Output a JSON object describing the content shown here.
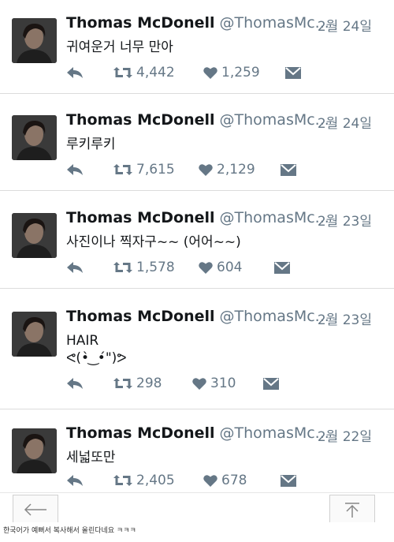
{
  "tweets": [
    {
      "name": "Thomas McDonell",
      "handle": "@ThomasMc...",
      "date": "2월 24일",
      "lines": [
        "귀여운거 너무 만아"
      ],
      "retweets": "4,442",
      "likes": "1,259"
    },
    {
      "name": "Thomas McDonell",
      "handle": "@ThomasMc...",
      "date": "2월 24일",
      "lines": [
        "루키루키"
      ],
      "retweets": "7,615",
      "likes": "2,129"
    },
    {
      "name": "Thomas McDonell",
      "handle": "@ThomasMc...",
      "date": "2월 23일",
      "lines": [
        "사진이나 찍자구~~ (어어~~)"
      ],
      "retweets": "1,578",
      "likes": "604"
    },
    {
      "name": "Thomas McDonell",
      "handle": "@ThomasMc...",
      "date": "2월 23일",
      "lines": [
        "HAIR",
        "ᕙ(•̀ ͜ •́\")ᕗ"
      ],
      "retweets": "298",
      "likes": "310"
    },
    {
      "name": "Thomas McDonell",
      "handle": "@ThomasMc...",
      "date": "2월 22일",
      "lines": [
        "세넓또만"
      ],
      "retweets": "2,405",
      "likes": "678"
    }
  ],
  "icons": {
    "reply": "reply-arrow-icon",
    "retweet": "retweet-icon",
    "like": "heart-icon",
    "dm": "direct-message-icon",
    "back": "back-arrow-icon",
    "top": "scroll-to-top-icon"
  },
  "colors": {
    "action_gray": "#657786",
    "text": "#14171a"
  },
  "caption": "한국어가 예뻐서 복사해서 올린다네요 ㅋㅋㅋ"
}
